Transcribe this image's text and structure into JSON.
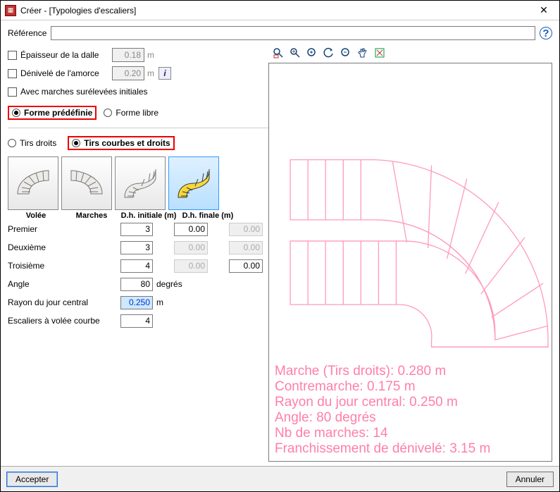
{
  "window": {
    "title": "Créer - [Typologies d'escaliers]"
  },
  "reference": {
    "label": "Référence",
    "value": ""
  },
  "options": {
    "slab_thickness": {
      "label": "Épaisseur de la dalle",
      "value": "0.18",
      "unit": "m",
      "checked": false
    },
    "start_offset": {
      "label": "Dénivelé de l'amorce",
      "value": "0.20",
      "unit": "m",
      "checked": false
    },
    "raised_initial": {
      "label": "Avec marches surélevées initiales",
      "checked": false
    },
    "shape_predef": {
      "label": "Forme prédéfinie"
    },
    "shape_free": {
      "label": "Forme libre"
    },
    "shape_selected": "predef"
  },
  "runs": {
    "straight": {
      "label": "Tirs droits"
    },
    "curved": {
      "label": "Tirs courbes et droits"
    },
    "selected": "curved"
  },
  "headers": {
    "volee": "Volée",
    "marches": "Marches",
    "dh_init": "D.h. initiale (m)",
    "dh_final": "D.h. finale (m)"
  },
  "rows": {
    "premier": {
      "label": "Premier",
      "marches": "3",
      "dh_init": "0.00",
      "dh_final": "0.00",
      "dh_init_enabled": true,
      "dh_final_enabled": false
    },
    "deuxieme": {
      "label": "Deuxième",
      "marches": "3",
      "dh_init": "0.00",
      "dh_final": "0.00",
      "dh_init_enabled": false,
      "dh_final_enabled": false
    },
    "troisieme": {
      "label": "Troisième",
      "marches": "4",
      "dh_init": "0.00",
      "dh_final": "0.00",
      "dh_init_enabled": false,
      "dh_final_enabled": true
    }
  },
  "extras": {
    "angle": {
      "label": "Angle",
      "value": "80",
      "unit": "degrés"
    },
    "rayon": {
      "label": "Rayon du jour central",
      "value": "0.250",
      "unit": "m"
    },
    "courbe": {
      "label": "Escaliers à volée courbe",
      "value": "4"
    }
  },
  "preview_info": {
    "l1": "Marche (Tirs droits): 0.280 m",
    "l2": "Contremarche: 0.175 m",
    "l3": "Rayon du jour central: 0.250 m",
    "l4": "Angle: 80 degrés",
    "l5": "Nb de marches: 14",
    "l6": "Franchissement de dénivelé: 3.15 m"
  },
  "footer": {
    "accept": "Accepter",
    "cancel": "Annuler"
  }
}
